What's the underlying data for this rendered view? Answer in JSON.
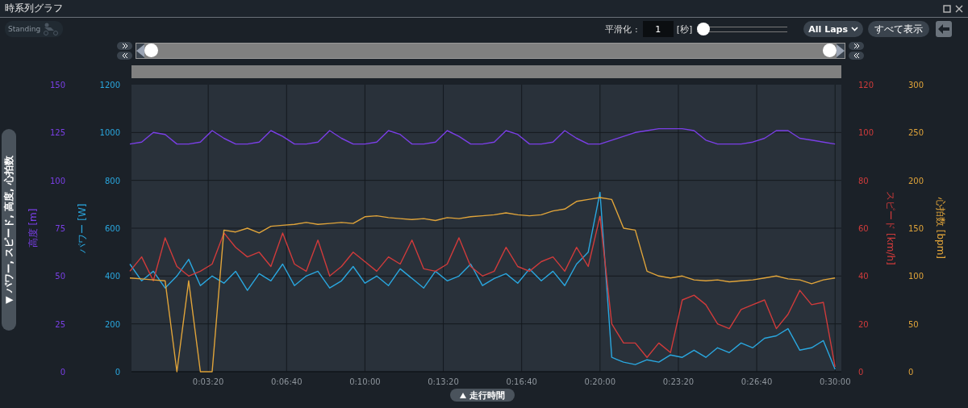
{
  "window": {
    "title": "時系列グラフ"
  },
  "toolbar": {
    "logo_text": "Standing",
    "smoothing_label": "平滑化 :",
    "smoothing_value": "1",
    "smoothing_unit": "[秒]",
    "smoothing_slider": {
      "level": 0
    },
    "lap_select": "All Laps",
    "show_all_button": "すべて表示"
  },
  "range_slider": {
    "thumbs": [
      {
        "level": 0
      },
      {
        "level": 1
      }
    ]
  },
  "graph": {
    "series_toggle": "▼ パワー, スピード, 高度, 心拍数",
    "charts": [
      {
        "chart_data": {
          "type": "line",
          "grid": true,
          "xlabel": "走行時間",
          "ylabel": "高度 [m]",
          "xlim": [
            0,
            1816
          ],
          "ylim": [
            0,
            150
          ],
          "yticks": [
            150,
            125,
            100,
            75,
            50,
            25,
            0
          ],
          "xticks": [
            {
              "value": 200,
              "label": "0:03:20"
            },
            {
              "value": 400,
              "label": "0:06:40"
            },
            {
              "value": 600,
              "label": "0:10:00"
            },
            {
              "value": 800,
              "label": "0:13:20"
            },
            {
              "value": 1000,
              "label": "0:16:40"
            },
            {
              "value": 1200,
              "label": "0:20:00"
            },
            {
              "value": 1400,
              "label": "0:23:20"
            },
            {
              "value": 1600,
              "label": "0:26:40"
            },
            {
              "value": 1800,
              "label": "0:30:00"
            }
          ],
          "x": [
            0,
            30,
            60,
            90,
            120,
            150,
            180,
            210,
            240,
            270,
            300,
            330,
            360,
            390,
            420,
            450,
            480,
            510,
            540,
            570,
            600,
            630,
            660,
            690,
            720,
            750,
            780,
            810,
            840,
            870,
            900,
            930,
            960,
            990,
            1020,
            1050,
            1080,
            1110,
            1140,
            1170,
            1200,
            1230,
            1260,
            1290,
            1320,
            1350,
            1380,
            1410,
            1440,
            1470,
            1500,
            1530,
            1560,
            1590,
            1620,
            1650,
            1680,
            1710,
            1740,
            1770,
            1800
          ],
          "series": [
            {
              "color": "#7a3fe6",
              "values": [
                119,
                120,
                125,
                124,
                119,
                119,
                120,
                126,
                122,
                119,
                119,
                120,
                126,
                123,
                119,
                119,
                120,
                126,
                122,
                119,
                119,
                120,
                126,
                124,
                119,
                119,
                120,
                126,
                123,
                119,
                119,
                120,
                126,
                124,
                119,
                119,
                120,
                126,
                122,
                119,
                119,
                121,
                123,
                125,
                126,
                127,
                127,
                127,
                126,
                121,
                119,
                119,
                119,
                120,
                122,
                126,
                126,
                122,
                121,
                120,
                119
              ]
            }
          ]
        }
      },
      {
        "chart_data": {
          "type": "line",
          "ylabel": "パワー [W]",
          "xlim": [
            0,
            1816
          ],
          "ylim": [
            0,
            1200
          ],
          "yticks": [
            1200,
            1000,
            800,
            600,
            400,
            200,
            0
          ],
          "x": [
            0,
            30,
            60,
            90,
            120,
            150,
            180,
            210,
            240,
            270,
            300,
            330,
            360,
            390,
            420,
            450,
            480,
            510,
            540,
            570,
            600,
            630,
            660,
            690,
            720,
            750,
            780,
            810,
            840,
            870,
            900,
            930,
            960,
            990,
            1020,
            1050,
            1080,
            1110,
            1140,
            1170,
            1200,
            1230,
            1260,
            1290,
            1320,
            1350,
            1380,
            1410,
            1440,
            1470,
            1500,
            1530,
            1560,
            1590,
            1620,
            1650,
            1680,
            1710,
            1740,
            1770,
            1800
          ],
          "series": [
            {
              "color": "#2aa7df",
              "values": [
                450,
                380,
                420,
                350,
                400,
                470,
                360,
                400,
                370,
                420,
                340,
                410,
                380,
                450,
                360,
                400,
                420,
                350,
                380,
                440,
                370,
                400,
                360,
                430,
                390,
                350,
                420,
                380,
                400,
                450,
                360,
                390,
                410,
                370,
                430,
                380,
                420,
                360,
                450,
                500,
                750,
                60,
                40,
                30,
                50,
                40,
                70,
                60,
                90,
                60,
                100,
                80,
                120,
                100,
                140,
                150,
                180,
                90,
                100,
                130,
                10
              ]
            }
          ]
        }
      },
      {
        "chart_data": {
          "type": "line",
          "ylabel": "スピード [km/h]",
          "xlim": [
            0,
            1816
          ],
          "ylim": [
            0,
            120
          ],
          "yticks": [
            120,
            100,
            80,
            60,
            40,
            20,
            0
          ],
          "x": [
            0,
            30,
            60,
            90,
            120,
            150,
            180,
            210,
            240,
            270,
            300,
            330,
            360,
            390,
            420,
            450,
            480,
            510,
            540,
            570,
            600,
            630,
            660,
            690,
            720,
            750,
            780,
            810,
            840,
            870,
            900,
            930,
            960,
            990,
            1020,
            1050,
            1080,
            1110,
            1140,
            1170,
            1200,
            1230,
            1260,
            1290,
            1320,
            1350,
            1380,
            1410,
            1440,
            1470,
            1500,
            1530,
            1560,
            1590,
            1620,
            1650,
            1680,
            1710,
            1740,
            1770,
            1800
          ],
          "series": [
            {
              "color": "#d03b3b",
              "values": [
                42,
                48,
                38,
                56,
                44,
                40,
                42,
                45,
                58,
                52,
                48,
                50,
                44,
                58,
                45,
                42,
                55,
                40,
                44,
                50,
                46,
                42,
                48,
                45,
                55,
                43,
                42,
                45,
                56,
                44,
                40,
                42,
                52,
                44,
                42,
                46,
                48,
                42,
                52,
                44,
                65,
                20,
                12,
                12,
                6,
                12,
                8,
                30,
                32,
                28,
                20,
                18,
                26,
                28,
                30,
                18,
                24,
                34,
                28,
                29,
                2
              ]
            }
          ]
        }
      },
      {
        "chart_data": {
          "type": "line",
          "ylabel": "心拍数 [bpm]",
          "xlim": [
            0,
            1816
          ],
          "ylim": [
            0,
            300
          ],
          "yticks": [
            300,
            250,
            200,
            150,
            100,
            50,
            0
          ],
          "x": [
            0,
            30,
            60,
            90,
            120,
            150,
            180,
            210,
            240,
            270,
            300,
            330,
            360,
            390,
            420,
            450,
            480,
            510,
            540,
            570,
            600,
            630,
            660,
            690,
            720,
            750,
            780,
            810,
            840,
            870,
            900,
            930,
            960,
            990,
            1020,
            1050,
            1080,
            1110,
            1140,
            1170,
            1200,
            1230,
            1260,
            1290,
            1320,
            1350,
            1380,
            1410,
            1440,
            1470,
            1500,
            1530,
            1560,
            1590,
            1620,
            1650,
            1680,
            1710,
            1740,
            1770,
            1800
          ],
          "series": [
            {
              "color": "#e0a43a",
              "values": [
                98,
                97,
                96,
                95,
                0,
                95,
                0,
                0,
                148,
                146,
                150,
                145,
                152,
                153,
                154,
                156,
                154,
                155,
                156,
                155,
                162,
                163,
                161,
                160,
                159,
                160,
                158,
                161,
                160,
                162,
                163,
                164,
                166,
                164,
                163,
                164,
                168,
                170,
                178,
                180,
                182,
                180,
                150,
                148,
                105,
                100,
                98,
                100,
                96,
                95,
                96,
                94,
                95,
                96,
                98,
                100,
                97,
                96,
                92,
                96,
                98
              ]
            }
          ]
        }
      }
    ]
  }
}
